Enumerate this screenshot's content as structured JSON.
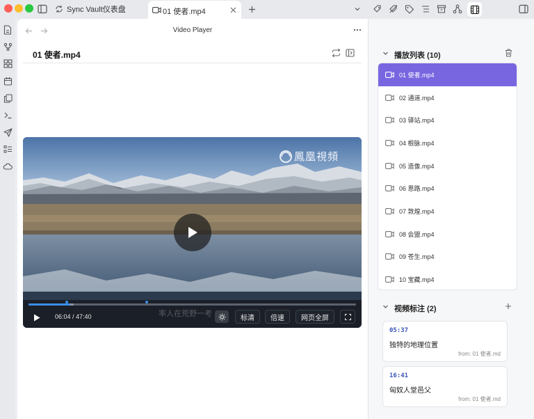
{
  "titlebar": {
    "tab1_label": "Sync Vault仪表盘",
    "tab2_label": "01 使者.mp4"
  },
  "pane": {
    "nav_title": "Video Player",
    "file_title": "01 使者.mp4"
  },
  "player": {
    "watermark": "鳳凰視頻",
    "time_current": "06:04",
    "time_total": "47:40",
    "time_display": "06:04 / 47:40",
    "progress_fraction": 0.127,
    "buffered_fraction": 0.137,
    "marker_fractions": [
      0.117,
      0.36
    ],
    "subtitle_faint": "率人在荒野一考",
    "buttons": {
      "quality": "标清",
      "speed": "倍速",
      "web_fullscreen": "网页全屏"
    }
  },
  "playlist": {
    "title": "播放列表 (10)",
    "items": [
      "01 使者.mp4",
      "02 通道.mp4",
      "03 驿站.mp4",
      "04 根脉.mp4",
      "05 造像.mp4",
      "06 恩路.mp4",
      "07 敦煌.mp4",
      "08 会盟.mp4",
      "09 苍生.mp4",
      "10 宝藏.mp4"
    ],
    "active_index": 0
  },
  "annotations": {
    "title": "视频标注 (2)",
    "notes": [
      {
        "time": "05:37",
        "text": "独特的地理位置",
        "source": "from: 01 使者.md"
      },
      {
        "time": "16:41",
        "text": "匈奴人堂邑父",
        "source": "from: 01 使者.md"
      }
    ]
  },
  "colors": {
    "accent": "#7866e0",
    "progress": "#3a8ee6",
    "note_time": "#3b56b8"
  }
}
